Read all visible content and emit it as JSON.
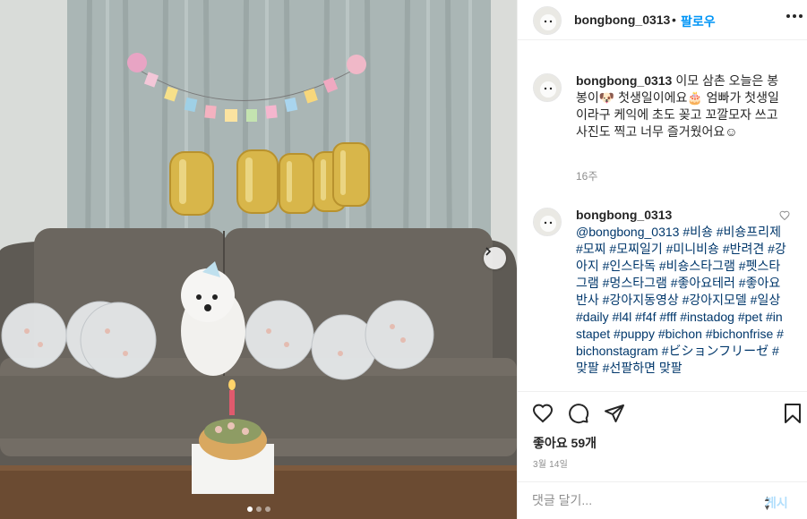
{
  "post": {
    "photo_alt": "photo",
    "carousel": {
      "count": 3,
      "active": 1
    }
  },
  "header": {
    "username": "bongbong_0313",
    "separator": "•",
    "follow_label": "팔로우"
  },
  "comments": [
    {
      "username": "bongbong_0313",
      "text": "이모 삼촌 오늘은 봉봉이🐶 첫생일이에요🎂 엄빠가 첫생일이라구 케익에 초도 꽂고 꼬깔모자 쓰고 사진도 찍고 너무 즐거웠어요☺",
      "time": "16주"
    },
    {
      "username": "bongbong_0313",
      "text": "@bongbong_0313 #비숑 #비숑프리제 #모찌 #모찌일기 #미니비숑 #반려견 #강아지 #인스타독 #비숑스타그램 #펫스타그램 #멍스타그램 #좋아요테러 #좋아요반사 #강아지동영상 #강아지모델 #일상 #daily #l4l #f4f #fff #instadog #pet #instapet #puppy #bichon #bichonfrise #bichonstagram #ビションフリーゼ #맞팔 #선팔하면 맞팔"
    }
  ],
  "likes": "좋아요 59개",
  "date": "3월 14일",
  "comment_input": {
    "placeholder": "댓글 달기...",
    "post_label": "게시"
  },
  "colors": {
    "accent": "#0095f6",
    "text": "#262626",
    "muted": "#8e8e8e",
    "border": "#efefef"
  },
  "icons": [
    "heart-icon",
    "comment-icon",
    "share-icon",
    "bookmark-icon",
    "more-icon",
    "chevron-right-icon"
  ]
}
